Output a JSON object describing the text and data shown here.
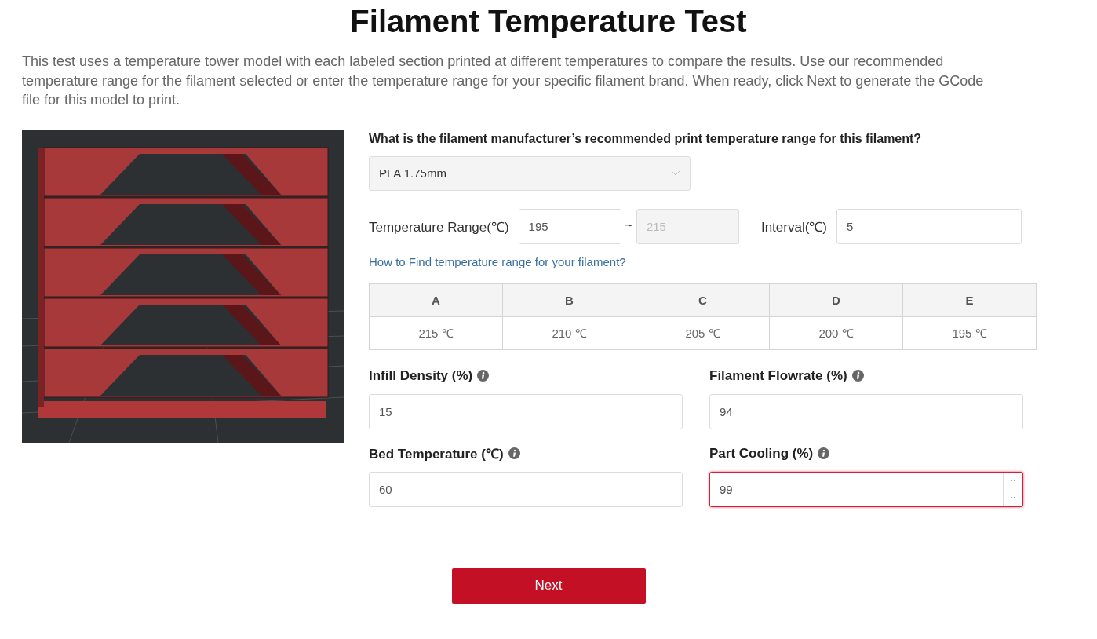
{
  "title": "Filament Temperature Test",
  "intro": "This test uses a temperature tower model with each labeled section printed at different temperatures to compare the results. Use our recommended temperature range for the filament selected or enter the temperature range for your specific filament brand. When ready, click Next to generate the GCode file for this model to print.",
  "question": "What is the filament manufacturer’s recommended print temperature range for this filament?",
  "filament_select": {
    "value": "PLA 1.75mm"
  },
  "range": {
    "label": "Temperature Range(℃)",
    "from": {
      "value": "195",
      "disabled": false
    },
    "separator": "~",
    "to": {
      "value": "215",
      "disabled": true
    }
  },
  "interval": {
    "label": "Interval(℃)",
    "value": "5"
  },
  "help_link": "How to Find temperature range for your filament?",
  "table": {
    "columns": [
      "A",
      "B",
      "C",
      "D",
      "E"
    ],
    "values": [
      "215 ℃",
      "210 ℃",
      "205 ℃",
      "200 ℃",
      "195 ℃"
    ]
  },
  "fields": [
    {
      "label": "Infill Density (%)",
      "value": "15",
      "invalid": false,
      "spinner": false
    },
    {
      "label": "Filament Flowrate (%)",
      "value": "94",
      "invalid": false,
      "spinner": false
    },
    {
      "label": "Bed Temperature (℃)",
      "value": "60",
      "invalid": false,
      "spinner": false
    },
    {
      "label": "Part Cooling (%)",
      "value": "99",
      "invalid": true,
      "spinner": true
    }
  ],
  "next_button": "Next"
}
